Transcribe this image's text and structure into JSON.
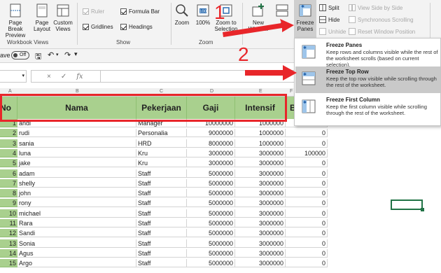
{
  "ribbon": {
    "workbook_views": {
      "label": "Workbook Views",
      "page_break": "Page Break\nPreview",
      "page_layout": "Page\nLayout",
      "custom_views": "Custom\nViews"
    },
    "show": {
      "label": "Show",
      "ruler": "Ruler",
      "formula_bar": "Formula Bar",
      "gridlines": "Gridlines",
      "headings": "Headings"
    },
    "zoom": {
      "label": "Zoom",
      "zoom": "Zoom",
      "hundred": "100%",
      "zoom_to_selection": "Zoom to\nSelection",
      "new_window": "New\nWindow",
      "arrange": "A"
    },
    "window": {
      "freeze": "Freeze\nPanes",
      "split": "Split",
      "hide": "Hide",
      "unhide": "Unhide",
      "side_by_side": "View Side by Side",
      "sync_scroll": "Synchronous Scrolling",
      "reset_pos": "Reset Window Position"
    }
  },
  "qat": {
    "autosave": "ave",
    "toggle": "Off"
  },
  "formula": {
    "fx": "fx",
    "cancel": "×",
    "enter": "✓"
  },
  "columns": [
    "A",
    "B",
    "C",
    "D",
    "E",
    "F"
  ],
  "table": {
    "headers": [
      "No",
      "Nama",
      "Pekerjaan",
      "Gaji",
      "Intensif",
      "B"
    ],
    "rows": [
      [
        "1",
        "andi",
        "Manager",
        "10000000",
        "1000000",
        "500000"
      ],
      [
        "2",
        "rudi",
        "Personalia",
        "9000000",
        "1000000",
        "0"
      ],
      [
        "3",
        "sania",
        "HRD",
        "8000000",
        "1000000",
        "0"
      ],
      [
        "4",
        "luna",
        "Kru",
        "3000000",
        "3000000",
        "100000"
      ],
      [
        "5",
        "jake",
        "Kru",
        "3000000",
        "3000000",
        "0"
      ],
      [
        "6",
        "adam",
        "Staff",
        "5000000",
        "3000000",
        "0"
      ],
      [
        "7",
        "shelly",
        "Staff",
        "5000000",
        "3000000",
        "0"
      ],
      [
        "8",
        "john",
        "Staff",
        "5000000",
        "3000000",
        "0"
      ],
      [
        "9",
        "rony",
        "Staff",
        "5000000",
        "3000000",
        "0"
      ],
      [
        "10",
        "michael",
        "Staff",
        "5000000",
        "3000000",
        "0"
      ],
      [
        "11",
        "Rara",
        "Staff",
        "5000000",
        "3000000",
        "0"
      ],
      [
        "12",
        "Sandi",
        "Staff",
        "5000000",
        "3000000",
        "0"
      ],
      [
        "13",
        "Sonia",
        "Staff",
        "5000000",
        "3000000",
        "0"
      ],
      [
        "14",
        "Agus",
        "Staff",
        "5000000",
        "3000000",
        "0"
      ],
      [
        "15",
        "Argo",
        "Staff",
        "5000000",
        "3000000",
        "0"
      ]
    ]
  },
  "dropdown": {
    "items": [
      {
        "title": "Freeze Panes",
        "desc": "Keep rows and columns visible while the rest of the worksheet scrolls (based on current selection)."
      },
      {
        "title": "Freeze Top Row",
        "desc": "Keep the top row visible while scrolling through the rest of the worksheet."
      },
      {
        "title": "Freeze First Column",
        "desc": "Keep the first column visible while scrolling through the rest of the worksheet."
      }
    ]
  },
  "annotations": {
    "step1": "1",
    "step2": "2"
  },
  "colors": {
    "header_green": "#a9d08e",
    "annotation_red": "#e8262a",
    "excel_green": "#217346"
  }
}
